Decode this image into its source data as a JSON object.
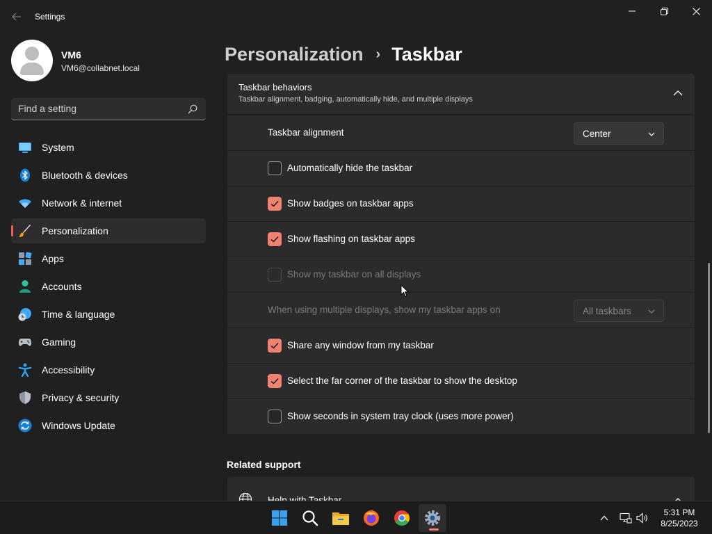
{
  "window": {
    "title": "Settings"
  },
  "profile": {
    "name": "VM6",
    "email": "VM6@collabnet.local"
  },
  "search": {
    "placeholder": "Find a setting"
  },
  "sidebar": {
    "items": [
      {
        "label": "System",
        "icon": "system-icon",
        "active": false
      },
      {
        "label": "Bluetooth & devices",
        "icon": "bluetooth-icon",
        "active": false
      },
      {
        "label": "Network & internet",
        "icon": "wifi-icon",
        "active": false
      },
      {
        "label": "Personalization",
        "icon": "brush-icon",
        "active": true
      },
      {
        "label": "Apps",
        "icon": "apps-icon",
        "active": false
      },
      {
        "label": "Accounts",
        "icon": "accounts-icon",
        "active": false
      },
      {
        "label": "Time & language",
        "icon": "time-language-icon",
        "active": false
      },
      {
        "label": "Gaming",
        "icon": "gamepad-icon",
        "active": false
      },
      {
        "label": "Accessibility",
        "icon": "accessibility-icon",
        "active": false
      },
      {
        "label": "Privacy & security",
        "icon": "shield-icon",
        "active": false
      },
      {
        "label": "Windows Update",
        "icon": "update-icon",
        "active": false
      }
    ]
  },
  "breadcrumb": {
    "parent": "Personalization",
    "separator": "›",
    "current": "Taskbar"
  },
  "behaviors": {
    "title": "Taskbar behaviors",
    "subtitle": "Taskbar alignment, badging, automatically hide, and multiple displays",
    "alignment": {
      "label": "Taskbar alignment",
      "value": "Center"
    },
    "auto_hide": {
      "label": "Automatically hide the taskbar",
      "checked": false
    },
    "badges": {
      "label": "Show badges on taskbar apps",
      "checked": true
    },
    "flashing": {
      "label": "Show flashing on taskbar apps",
      "checked": true
    },
    "all_displays": {
      "label": "Show my taskbar on all displays",
      "checked": false,
      "disabled": true
    },
    "multi_display": {
      "label": "When using multiple displays, show my taskbar apps on",
      "value": "All taskbars",
      "disabled": true
    },
    "share_window": {
      "label": "Share any window from my taskbar",
      "checked": true
    },
    "far_corner": {
      "label": "Select the far corner of the taskbar to show the desktop",
      "checked": true
    },
    "seconds": {
      "label": "Show seconds in system tray clock (uses more power)",
      "checked": false
    }
  },
  "related": {
    "title": "Related support",
    "help_label": "Help with Taskbar"
  },
  "taskbar": {
    "apps": [
      "start-icon",
      "search-icon",
      "file-explorer-icon",
      "firefox-icon",
      "chrome-icon",
      "settings-icon"
    ],
    "tray": [
      "chevron-up-icon",
      "network-icon",
      "volume-icon"
    ],
    "time": "5:31 PM",
    "date": "8/25/2023"
  },
  "colors": {
    "accent": "#f0826f",
    "background": "#202020",
    "card": "#2b2b2b"
  }
}
